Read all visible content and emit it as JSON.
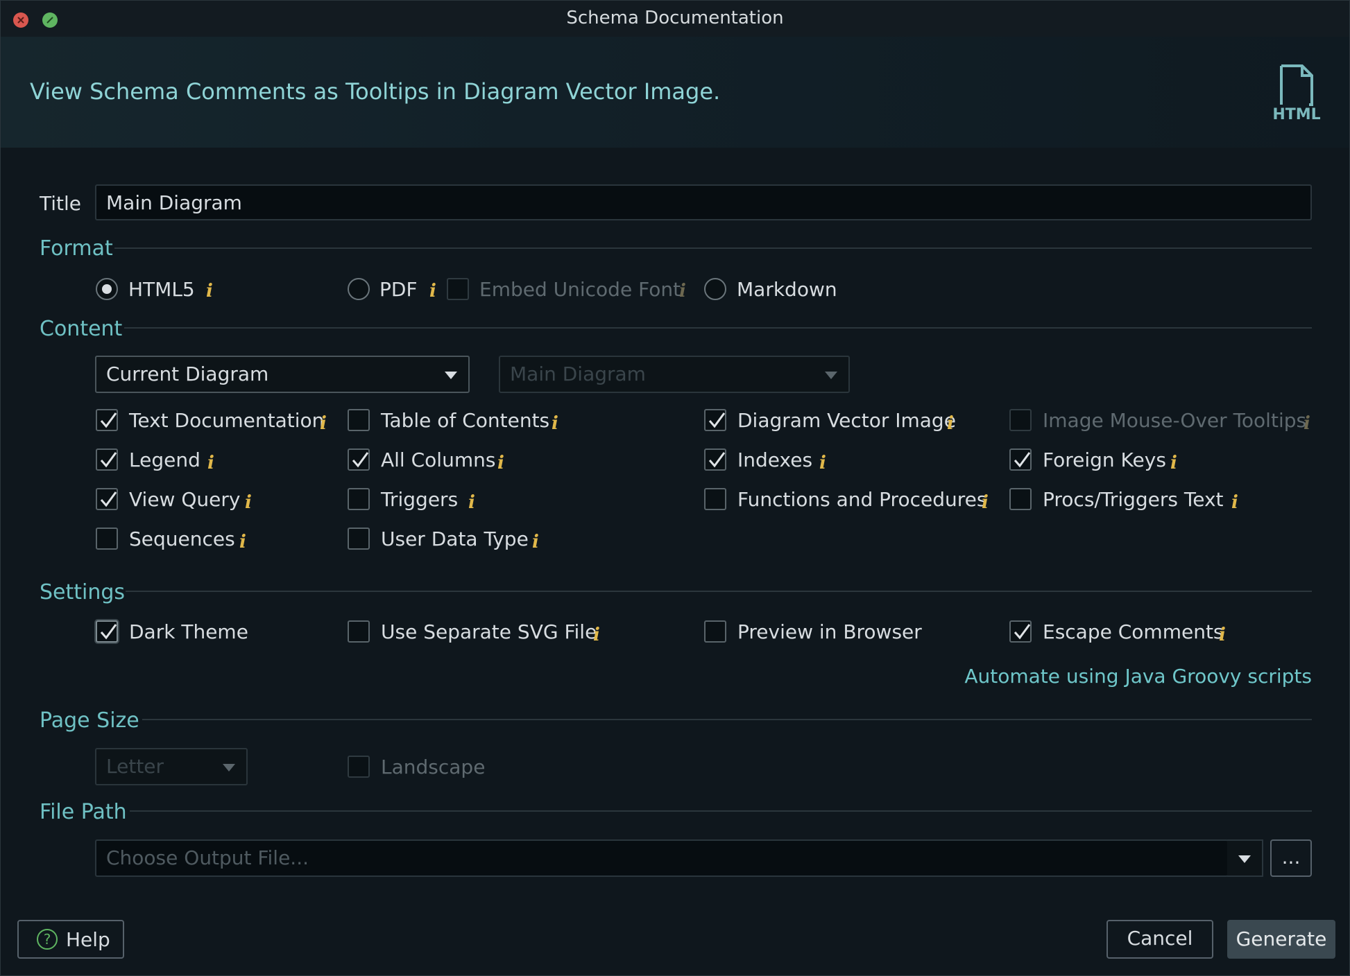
{
  "window": {
    "title": "Schema Documentation"
  },
  "banner": {
    "text": "View Schema Comments as Tooltips in Diagram Vector Image.",
    "icon": "html-file-icon",
    "icon_label": "HTML"
  },
  "title_field": {
    "label": "Title",
    "value": "Main Diagram"
  },
  "format": {
    "section": "Format",
    "options": {
      "html5": {
        "label": "HTML5",
        "checked": true
      },
      "pdf": {
        "label": "PDF",
        "checked": false
      },
      "embed_unicode_font": {
        "label": "Embed Unicode Font",
        "checked": false,
        "disabled": true
      },
      "markdown": {
        "label": "Markdown",
        "checked": false
      }
    }
  },
  "content": {
    "section": "Content",
    "scope_select": {
      "value": "Current Diagram"
    },
    "diagram_select": {
      "value": "Main Diagram",
      "disabled": true
    },
    "checkboxes": {
      "text_documentation": {
        "label": "Text Documentation",
        "checked": true
      },
      "table_of_contents": {
        "label": "Table of Contents",
        "checked": false
      },
      "diagram_vector_image": {
        "label": "Diagram Vector Image",
        "checked": true
      },
      "image_mouse_over_tooltips": {
        "label": "Image Mouse-Over Tooltips",
        "checked": false,
        "disabled": true
      },
      "legend": {
        "label": "Legend",
        "checked": true
      },
      "all_columns": {
        "label": "All Columns",
        "checked": true
      },
      "indexes": {
        "label": "Indexes",
        "checked": true
      },
      "foreign_keys": {
        "label": "Foreign Keys",
        "checked": true
      },
      "view_query": {
        "label": "View Query",
        "checked": true
      },
      "triggers": {
        "label": "Triggers",
        "checked": false
      },
      "functions_and_procedures": {
        "label": "Functions and Procedures",
        "checked": false
      },
      "procs_triggers_text": {
        "label": "Procs/Triggers Text",
        "checked": false
      },
      "sequences": {
        "label": "Sequences",
        "checked": false
      },
      "user_data_type": {
        "label": "User Data Type",
        "checked": false
      }
    }
  },
  "settings": {
    "section": "Settings",
    "checkboxes": {
      "dark_theme": {
        "label": "Dark Theme",
        "checked": true
      },
      "use_separate_svg_file": {
        "label": "Use Separate SVG File",
        "checked": false
      },
      "preview_in_browser": {
        "label": "Preview in Browser",
        "checked": false
      },
      "escape_comments": {
        "label": "Escape Comments",
        "checked": true
      }
    },
    "automate_link": "Automate using Java Groovy scripts"
  },
  "page_size": {
    "section": "Page Size",
    "select": {
      "value": "Letter",
      "disabled": true
    },
    "landscape": {
      "label": "Landscape",
      "checked": false,
      "disabled": true
    }
  },
  "file_path": {
    "section": "File Path",
    "placeholder": "Choose Output File...",
    "browse_label": "..."
  },
  "footer": {
    "help_label": "Help",
    "cancel_label": "Cancel",
    "generate_label": "Generate"
  },
  "colors": {
    "background": "#0f171d",
    "accent": "#6fc1c4",
    "info_icon": "#e1b84a",
    "close_button": "#d9574f",
    "maximize_button": "#5fb561"
  },
  "info_glyph": "i"
}
